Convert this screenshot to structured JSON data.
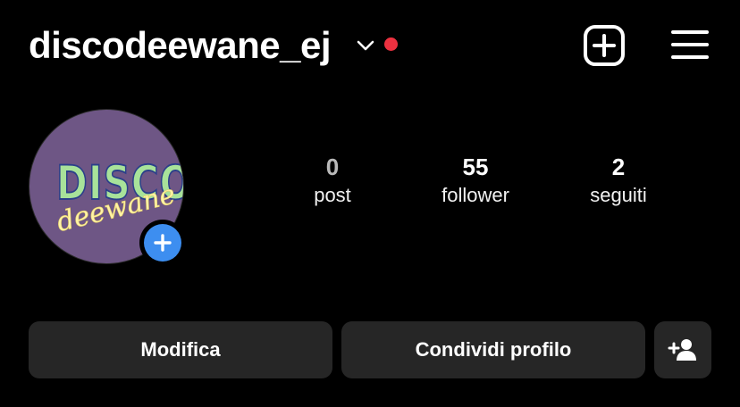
{
  "header": {
    "username": "discodeewane_ej",
    "account_switcher_icon": "chevron-down-icon",
    "notification_color": "#ed3140",
    "new_post_icon": "plus-square-icon",
    "menu_icon": "hamburger-menu-icon"
  },
  "profile": {
    "avatar_logo_word_1": "DISCO",
    "avatar_logo_word_2": "deewane",
    "add_story_icon": "plus-icon",
    "accent_color": "#3d8ef0"
  },
  "stats": [
    {
      "value": "0",
      "label": "post"
    },
    {
      "value": "55",
      "label": "follower"
    },
    {
      "value": "2",
      "label": "seguiti"
    }
  ],
  "actions": {
    "edit_label": "Modifica",
    "share_label": "Condividi profilo",
    "add_user_icon": "add-person-icon"
  }
}
